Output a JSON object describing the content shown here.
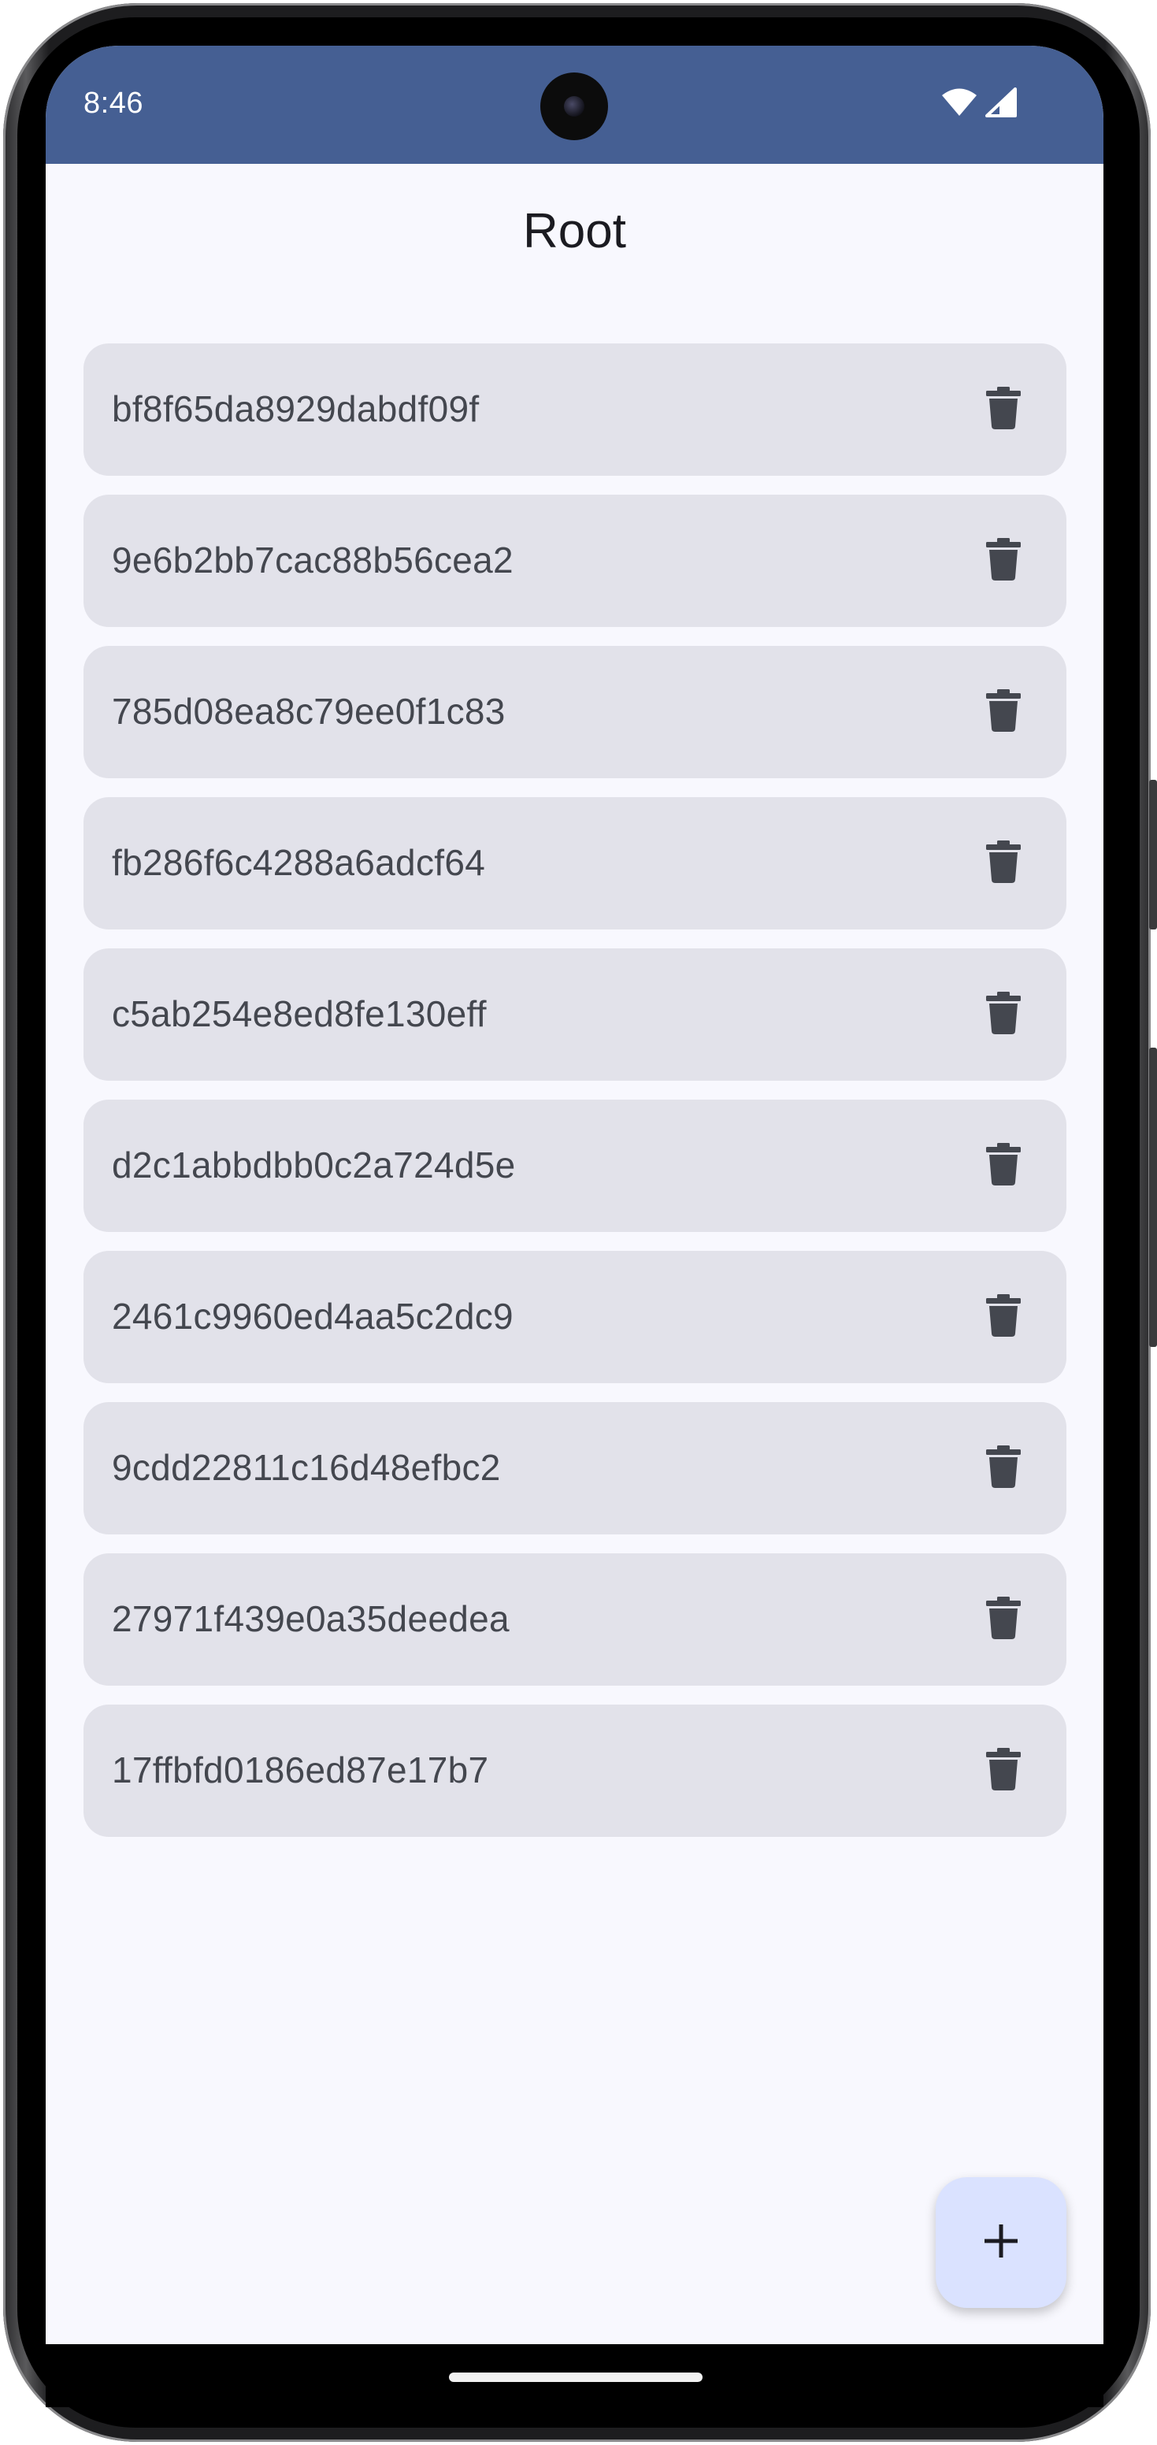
{
  "status_bar": {
    "time": "8:46",
    "background_color": "#455f93",
    "icons": [
      "wifi-icon",
      "cell-signal-icon"
    ]
  },
  "app_bar": {
    "title": "Root"
  },
  "items": [
    {
      "label": "bf8f65da8929dabdf09f",
      "action_icon": "trash-icon"
    },
    {
      "label": "9e6b2bb7cac88b56cea2",
      "action_icon": "trash-icon"
    },
    {
      "label": "785d08ea8c79ee0f1c83",
      "action_icon": "trash-icon"
    },
    {
      "label": "fb286f6c4288a6adcf64",
      "action_icon": "trash-icon"
    },
    {
      "label": "c5ab254e8ed8fe130eff",
      "action_icon": "trash-icon"
    },
    {
      "label": "d2c1abbdbb0c2a724d5e",
      "action_icon": "trash-icon"
    },
    {
      "label": "2461c9960ed4aa5c2dc9",
      "action_icon": "trash-icon"
    },
    {
      "label": "9cdd22811c16d48efbc2",
      "action_icon": "trash-icon"
    },
    {
      "label": "27971f439e0a35deedea",
      "action_icon": "trash-icon"
    },
    {
      "label": "17ffbfd0186ed87e17b7",
      "action_icon": "trash-icon"
    }
  ],
  "fab": {
    "icon": "plus-icon",
    "background_color": "#dae2ff"
  },
  "colors": {
    "screen_background": "#f8f8fe",
    "item_background": "#e2e2ea",
    "item_text": "#44474f",
    "icon": "#44474f"
  }
}
